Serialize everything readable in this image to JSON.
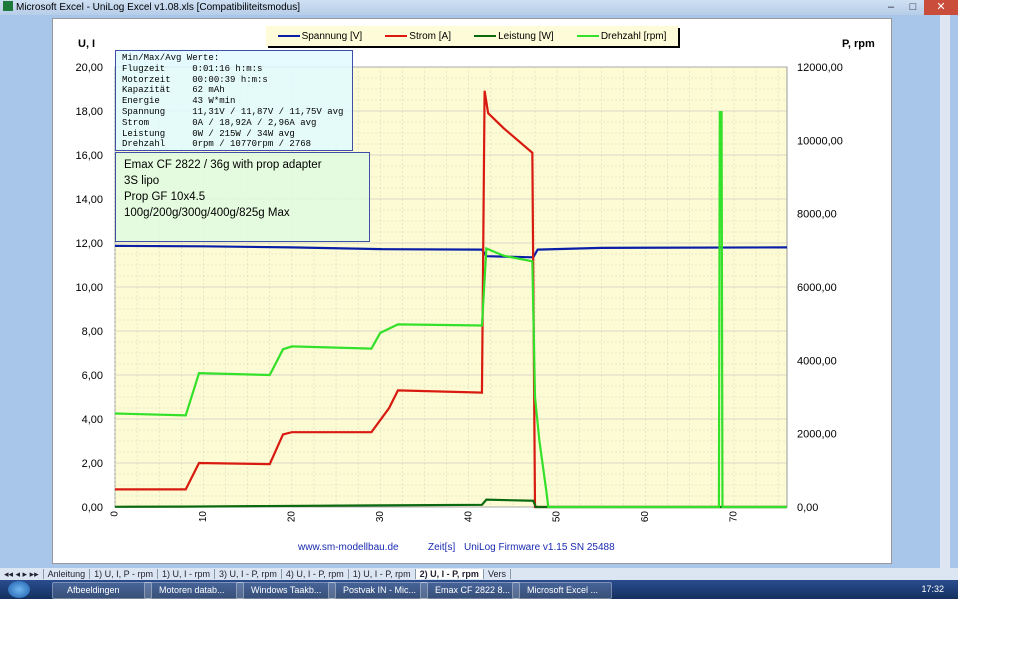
{
  "window": {
    "title": "Microsoft Excel - UniLog Excel v1.08.xls  [Compatibiliteitsmodus]",
    "min": "–",
    "max": "□",
    "close": "✕"
  },
  "legend": [
    {
      "label": "Spannung [V]",
      "color": "#0a1fa8"
    },
    {
      "label": "Strom [A]",
      "color": "#d81a10"
    },
    {
      "label": "Leistung [W]",
      "color": "#0b6a10"
    },
    {
      "label": "Drehzahl [rpm]",
      "color": "#33e02a"
    }
  ],
  "stats": {
    "lines": [
      "Min/Max/Avg Werte:",
      "Flugzeit     0:01:16 h:m:s",
      "Motorzeit    00:00:39 h:m:s",
      "Kapazität    62 mAh",
      "Energie      43 W*min",
      "Spannung     11,31V / 11,87V / 11,75V avg",
      "Strom        0A / 18,92A / 2,96A avg",
      "Leistung     0W / 215W / 34W avg",
      "Drehzahl     0rpm / 10770rpm / 2768"
    ]
  },
  "notes": [
    "Emax CF 2822 / 36g with prop adapter",
    "3S lipo",
    "Prop GF 10x4.5",
    "100g/200g/300g/400g/825g Max"
  ],
  "chart_data": {
    "type": "line",
    "title": "",
    "xlabel": "Zeit[s]",
    "ylabel": "U, I",
    "y2label": "P, rpm",
    "xlim": [
      0,
      76
    ],
    "ylim": [
      0,
      20
    ],
    "y2lim": [
      0,
      12000
    ],
    "xticks": [
      0,
      10,
      20,
      30,
      40,
      50,
      60,
      70
    ],
    "yticks": [
      "0,00",
      "2,00",
      "4,00",
      "6,00",
      "8,00",
      "10,00",
      "12,00",
      "14,00",
      "16,00",
      "18,00",
      "20,00"
    ],
    "y2ticks": [
      "0,00",
      "2000,00",
      "4000,00",
      "6000,00",
      "8000,00",
      "10000,00",
      "12000,00"
    ],
    "footer_left": "www.sm-modellbau.de",
    "footer_right": "UniLog Firmware v1.15 SN 25488",
    "grid": true,
    "series": [
      {
        "name": "Spannung [V]",
        "axis": "y",
        "color": "#0a1fa8",
        "points": [
          [
            0,
            11.87
          ],
          [
            10,
            11.85
          ],
          [
            20,
            11.8
          ],
          [
            30,
            11.72
          ],
          [
            41.5,
            11.7
          ],
          [
            42,
            11.4
          ],
          [
            47.3,
            11.35
          ],
          [
            47.8,
            11.7
          ],
          [
            55,
            11.78
          ],
          [
            76,
            11.8
          ]
        ]
      },
      {
        "name": "Strom [A]",
        "axis": "y",
        "color": "#d81a10",
        "points": [
          [
            0,
            0.8
          ],
          [
            8,
            0.8
          ],
          [
            9.5,
            2.0
          ],
          [
            17.5,
            1.95
          ],
          [
            19,
            3.3
          ],
          [
            20,
            3.4
          ],
          [
            29,
            3.4
          ],
          [
            31,
            4.5
          ],
          [
            32,
            5.3
          ],
          [
            41.5,
            5.2
          ],
          [
            41.8,
            18.92
          ],
          [
            42.2,
            17.9
          ],
          [
            44,
            17.2
          ],
          [
            47.2,
            16.1
          ],
          [
            47.5,
            0
          ],
          [
            76,
            0
          ]
        ]
      },
      {
        "name": "Leistung [W]",
        "axis": "y2",
        "color": "#0b6a10",
        "points": [
          [
            0,
            5
          ],
          [
            8,
            10
          ],
          [
            17,
            25
          ],
          [
            30,
            45
          ],
          [
            41.5,
            60
          ],
          [
            42,
            200
          ],
          [
            47.3,
            170
          ],
          [
            47.6,
            0
          ],
          [
            76,
            0
          ]
        ]
      },
      {
        "name": "Drehzahl [rpm]",
        "axis": "y2",
        "color": "#33e02a",
        "points": [
          [
            0,
            2550
          ],
          [
            8,
            2500
          ],
          [
            9.5,
            3650
          ],
          [
            17.5,
            3600
          ],
          [
            19,
            4300
          ],
          [
            20,
            4380
          ],
          [
            29,
            4320
          ],
          [
            30,
            4750
          ],
          [
            32,
            4980
          ],
          [
            41.5,
            4950
          ],
          [
            42,
            7050
          ],
          [
            44,
            6850
          ],
          [
            47.2,
            6700
          ],
          [
            47.5,
            3000
          ],
          [
            48,
            1800
          ],
          [
            48.8,
            400
          ],
          [
            49,
            0
          ],
          [
            68.3,
            0
          ],
          [
            68.4,
            10770
          ],
          [
            68.6,
            10770
          ],
          [
            68.7,
            0
          ],
          [
            76,
            0
          ]
        ]
      }
    ]
  },
  "sheet_tabs": [
    "Anleitung",
    "1) U, I, P - rpm",
    "1) U, I - rpm",
    "3) U, I - P, rpm",
    "4) U, I - P, rpm",
    "1) U, I - P, rpm",
    "2) U, I - P, rpm",
    "Vers"
  ],
  "active_tab": "2) U, I - P, rpm",
  "taskbar": [
    "Afbeeldingen",
    "Motoren datab...",
    "Windows Taakb...",
    "Postvak IN - Mic...",
    "Emax CF 2822 8...",
    "Microsoft Excel ..."
  ],
  "clock": "17:32"
}
